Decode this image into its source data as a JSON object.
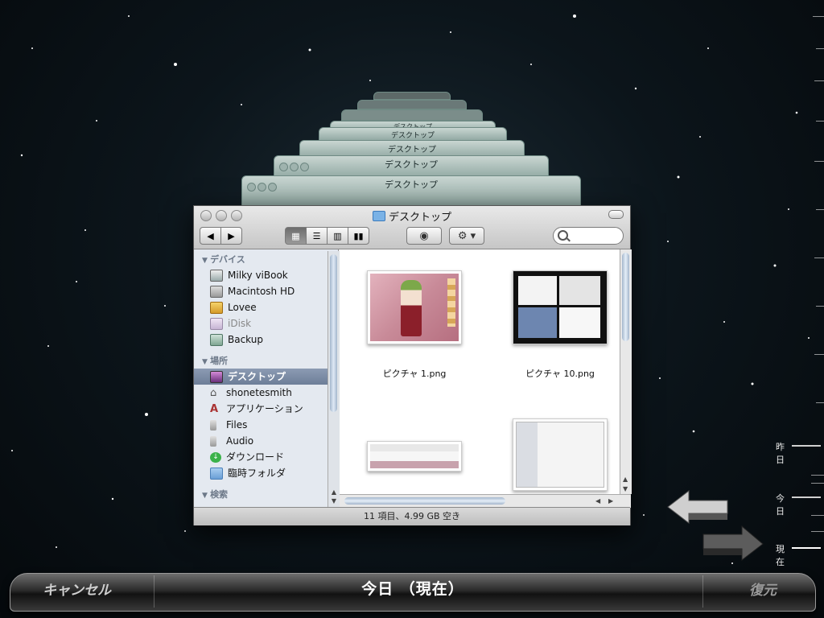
{
  "window": {
    "title": "デスクトップ",
    "status": "11 項目、4.99 GB 空き"
  },
  "backup_windows": {
    "title": "デスクトップ"
  },
  "sidebar": {
    "sections": [
      {
        "heading": "デバイス",
        "items": [
          {
            "label": "Milky viBook",
            "icon": "laptop-icon"
          },
          {
            "label": "Macintosh HD",
            "icon": "hard-drive-icon"
          },
          {
            "label": "Lovee",
            "icon": "drive-icon"
          },
          {
            "label": "iDisk",
            "icon": "idisk-icon"
          },
          {
            "label": "Backup",
            "icon": "backup-drive-icon"
          }
        ]
      },
      {
        "heading": "場所",
        "items": [
          {
            "label": "デスクトップ",
            "icon": "desktop-icon",
            "selected": true
          },
          {
            "label": "shonetesmith",
            "icon": "home-icon"
          },
          {
            "label": "アプリケーション",
            "icon": "applications-icon"
          },
          {
            "label": "Files",
            "icon": "folder-icon"
          },
          {
            "label": "Audio",
            "icon": "folder-icon"
          },
          {
            "label": "ダウンロード",
            "icon": "downloads-icon"
          },
          {
            "label": "臨時フォルダ",
            "icon": "folder-icon"
          }
        ]
      },
      {
        "heading": "検索",
        "items": []
      }
    ]
  },
  "files": [
    {
      "name": "ピクチャ 1.png"
    },
    {
      "name": "ピクチャ 10.png"
    },
    {
      "name": ""
    },
    {
      "name": ""
    }
  ],
  "timeline": {
    "yesterday": "昨日",
    "today": "今日",
    "now": "現在"
  },
  "bottom_bar": {
    "cancel": "キャンセル",
    "title": "今日 （現在）",
    "restore": "復元"
  },
  "colors": {
    "selection": "#7d8ca6",
    "sidebar_bg": "#e4e9f0"
  }
}
